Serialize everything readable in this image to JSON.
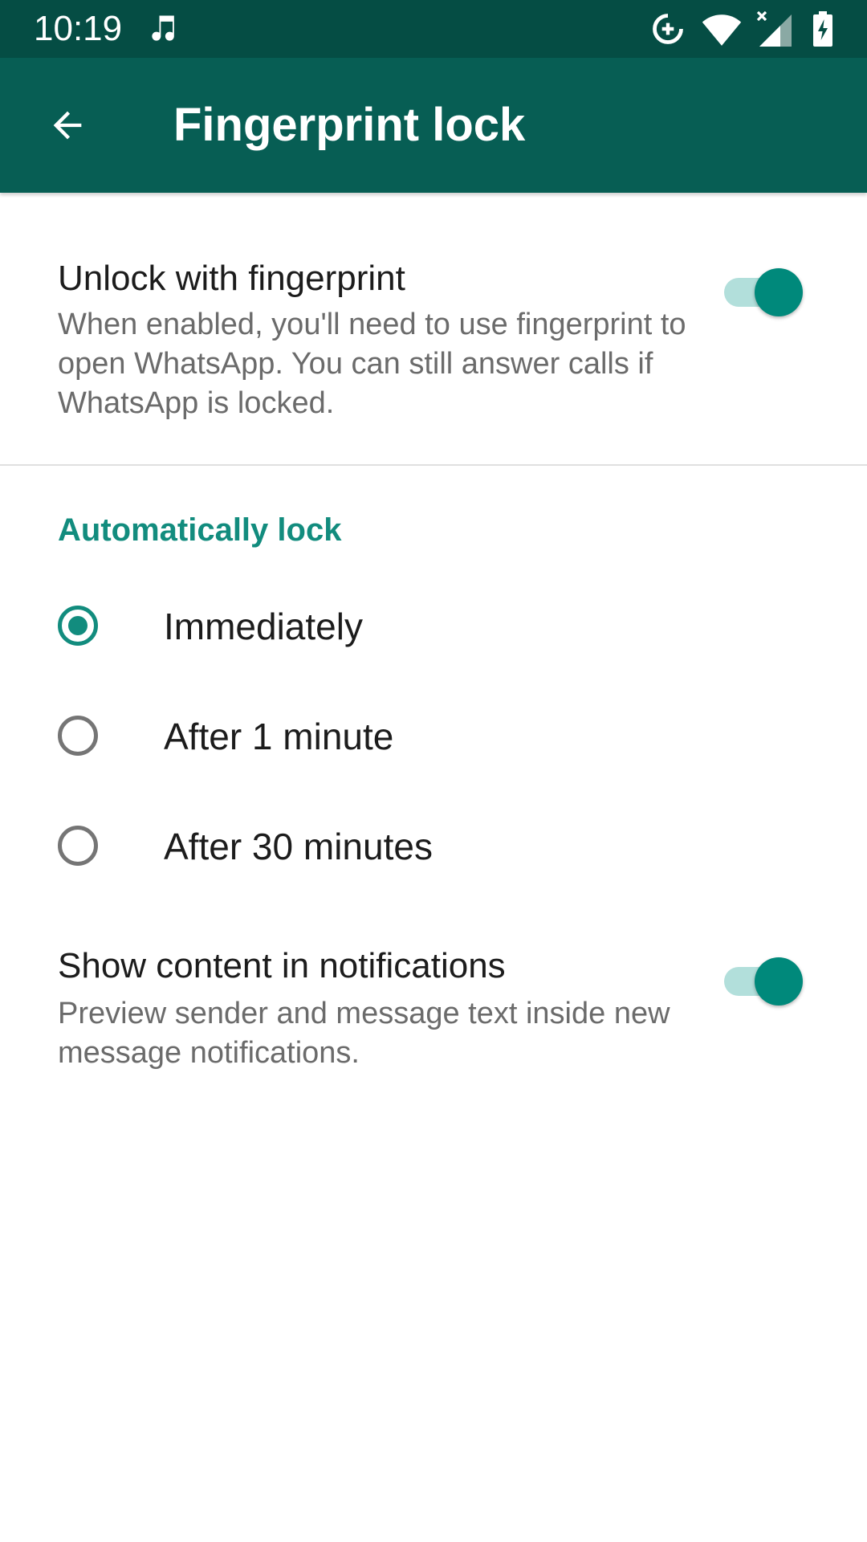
{
  "status_bar": {
    "time": "10:19",
    "icons": [
      "music-note-icon",
      "data-saver-icon",
      "wifi-icon",
      "cell-signal-icon",
      "battery-charging-icon"
    ]
  },
  "app_bar": {
    "title": "Fingerprint lock",
    "back_icon": "arrow-back-icon"
  },
  "settings": {
    "unlock": {
      "title": "Unlock with fingerprint",
      "summary": "When enabled, you'll need to use fingerprint to open WhatsApp. You can still answer calls if WhatsApp is locked.",
      "enabled": true
    },
    "auto_lock": {
      "header": "Automatically lock",
      "options": [
        {
          "label": "Immediately",
          "selected": true
        },
        {
          "label": "After 1 minute",
          "selected": false
        },
        {
          "label": "After 30 minutes",
          "selected": false
        }
      ]
    },
    "show_content": {
      "title": "Show content in notifications",
      "summary": "Preview sender and message text inside new message notifications.",
      "enabled": true
    }
  },
  "colors": {
    "status_bar": "#054d44",
    "app_bar": "#075e54",
    "accent": "#128c7e",
    "switch_thumb": "#00897b",
    "switch_track": "#b2dfdb"
  }
}
